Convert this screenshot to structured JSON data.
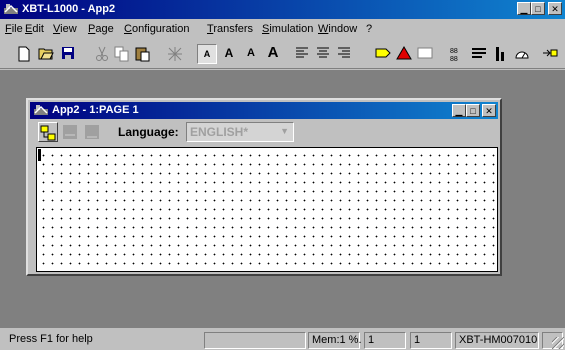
{
  "window": {
    "title": "XBT-L1000 - App2",
    "caption_buttons": [
      "minimize",
      "maximize",
      "close"
    ]
  },
  "menu": [
    "File",
    "Edit",
    "View",
    "Page",
    "Configuration",
    "Transfers",
    "Simulation",
    "Window",
    "?"
  ],
  "toolbar": {
    "buttons": [
      "new-icon",
      "open-icon",
      "save-icon",
      "cut-icon",
      "copy-icon",
      "paste-icon",
      "grid-icon",
      "font-small-icon",
      "font-medium-icon",
      "font-large-icon",
      "font-xlarge-icon",
      "align-left-icon",
      "align-center-icon",
      "align-right-icon",
      "rectangle-icon",
      "triangle-icon",
      "window-icon",
      "fields-icon",
      "table-icon",
      "bar-icon",
      "gauge-icon",
      "arrow-icon"
    ],
    "font_letters": [
      "A",
      "A",
      "A",
      "A"
    ]
  },
  "child_window": {
    "title": "App2 - 1:PAGE 1",
    "language_label": "Language:",
    "language_value": "ENGLISH*"
  },
  "status": {
    "help": "Press F1 for help",
    "memory": "Mem:1 %.",
    "field1": "1",
    "field2": "1",
    "terminal": "XBT-HM007010"
  },
  "colors": {
    "titlebar": "#000080",
    "face": "#c0c0c0",
    "mdi": "#808080"
  }
}
